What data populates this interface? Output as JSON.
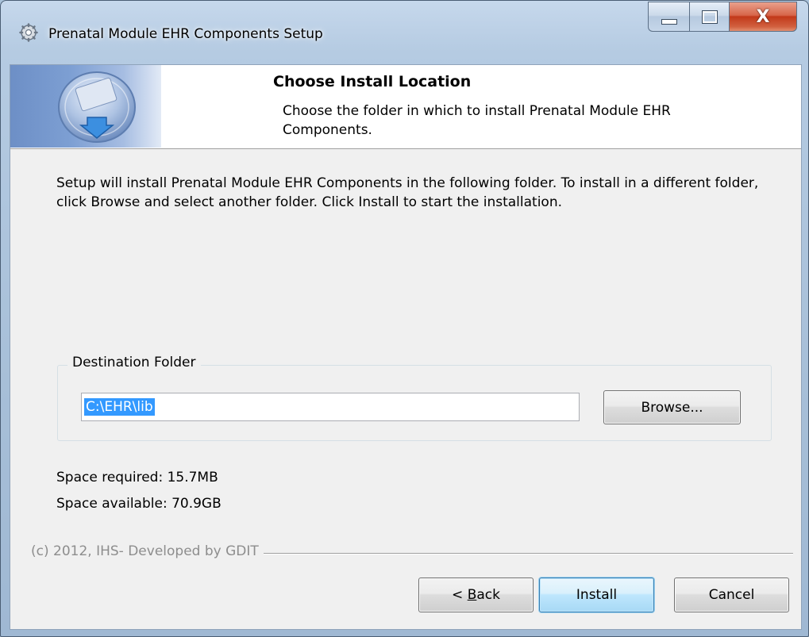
{
  "window": {
    "title": "Prenatal Module EHR Components Setup",
    "icon": "setup-gear-icon",
    "caption_buttons": {
      "minimize_icon": "minimize-icon",
      "maximize_icon": "maximize-icon",
      "close_glyph": "X"
    }
  },
  "header": {
    "title": "Choose Install Location",
    "subtitle": "Choose the folder in which to install Prenatal Module EHR Components.",
    "graphic_icon": "install-disc-icon"
  },
  "body": {
    "intro": "Setup will install Prenatal Module EHR Components in the following folder. To install in a different folder, click Browse and select another folder. Click Install to start the installation."
  },
  "destination": {
    "legend": "Destination Folder",
    "path": "C:\\EHR\\lib",
    "browse_label": "Browse..."
  },
  "space": {
    "required": "Space required: 15.7MB",
    "available": "Space available: 70.9GB"
  },
  "footer": {
    "branding": "(c) 2012, IHS- Developed by GDIT",
    "back_accel": "B",
    "back_rest": "ack",
    "back_prefix": "< ",
    "install_label": "Install",
    "cancel_label": "Cancel"
  },
  "colors": {
    "selection": "#3399ff",
    "header_gradient_start": "#6d8fc6",
    "close_button": "#c2391a",
    "branding_text": "#8d8d8d"
  }
}
